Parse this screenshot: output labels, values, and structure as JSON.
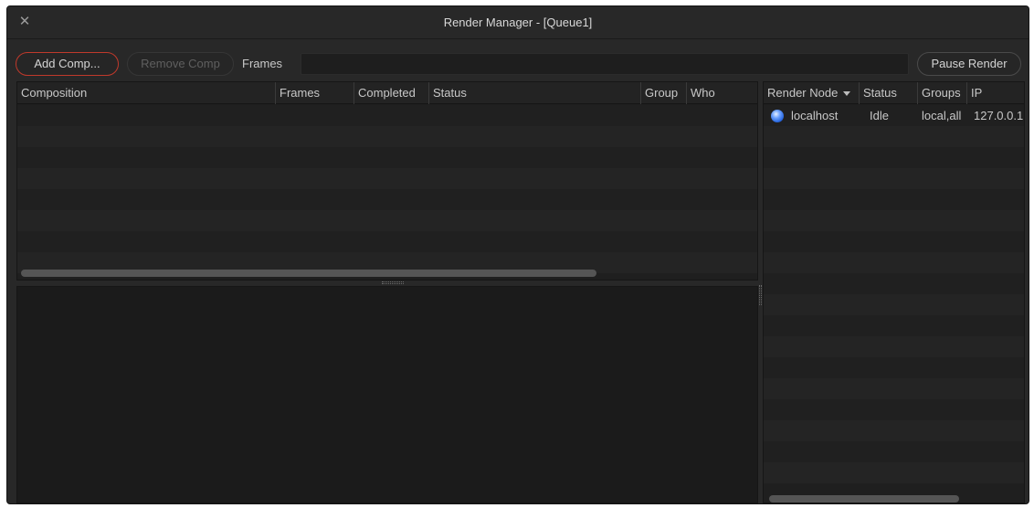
{
  "window": {
    "title": "Render Manager - [Queue1]",
    "close_icon": "close-icon"
  },
  "toolbar": {
    "add_comp_label": "Add Comp...",
    "remove_comp_label": "Remove Comp",
    "frames_label": "Frames",
    "frames_value": "",
    "pause_render_label": "Pause Render"
  },
  "comp_table": {
    "columns": [
      "Composition",
      "Frames",
      "Completed",
      "Status",
      "Group",
      "Who"
    ],
    "rows": []
  },
  "node_table": {
    "columns": [
      "Render Node",
      "Status",
      "Groups",
      "IP"
    ],
    "sort_column": "Render Node",
    "rows": [
      {
        "status_icon": "node-status-icon",
        "node": "localhost",
        "status": "Idle",
        "groups": "local,all",
        "ip": "127.0.0.1"
      }
    ]
  },
  "colors": {
    "accent_red": "#c0392b",
    "node_blue": "#3a78f0",
    "background": "#282828"
  }
}
